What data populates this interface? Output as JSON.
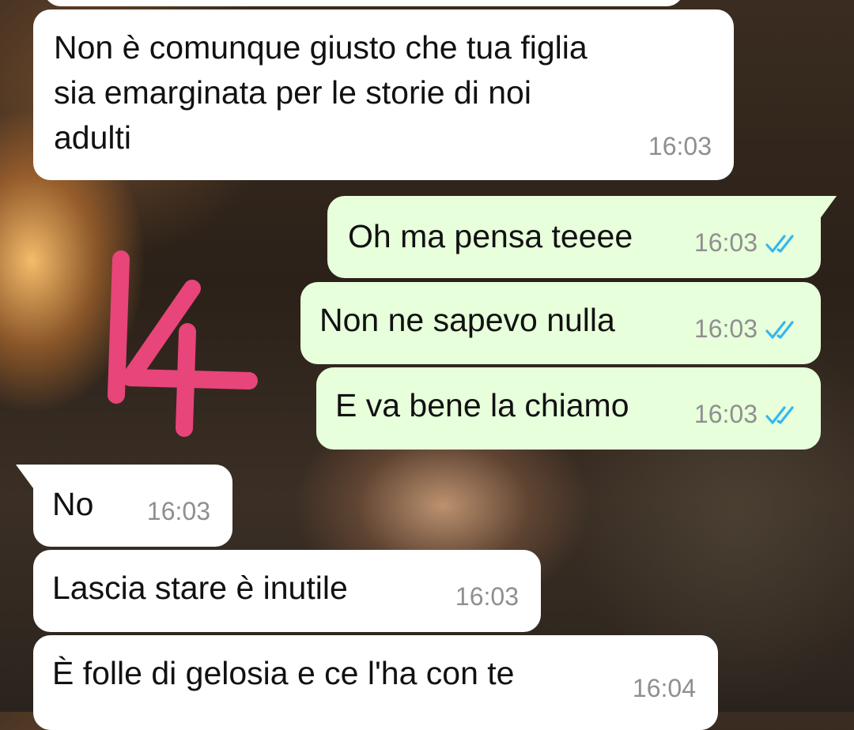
{
  "messages": [
    {
      "direction": "incoming",
      "text": "Non è comunque giusto che tua figlia\nsia emarginata per le storie di noi\nadulti",
      "time": "16:03"
    },
    {
      "direction": "outgoing",
      "text": "Oh ma pensa teeee",
      "time": "16:03",
      "status": "read"
    },
    {
      "direction": "outgoing",
      "text": "Non ne sapevo nulla",
      "time": "16:03",
      "status": "read"
    },
    {
      "direction": "outgoing",
      "text": "E va bene la chiamo",
      "time": "16:03",
      "status": "read"
    },
    {
      "direction": "incoming",
      "text": "No",
      "time": "16:03"
    },
    {
      "direction": "incoming",
      "text": "Lascia stare è inutile",
      "time": "16:03"
    },
    {
      "direction": "incoming",
      "text": "È folle di gelosia e ce l'ha con te",
      "time": "16:04"
    }
  ],
  "annotation": {
    "text": "14",
    "color": "#e8457a"
  },
  "colors": {
    "incoming_bubble": "#ffffff",
    "outgoing_bubble": "#e7ffdb",
    "read_tick": "#34b7f1",
    "timestamp": "#8f8f8f"
  },
  "icons": {
    "read_receipt": "double-check-icon"
  }
}
